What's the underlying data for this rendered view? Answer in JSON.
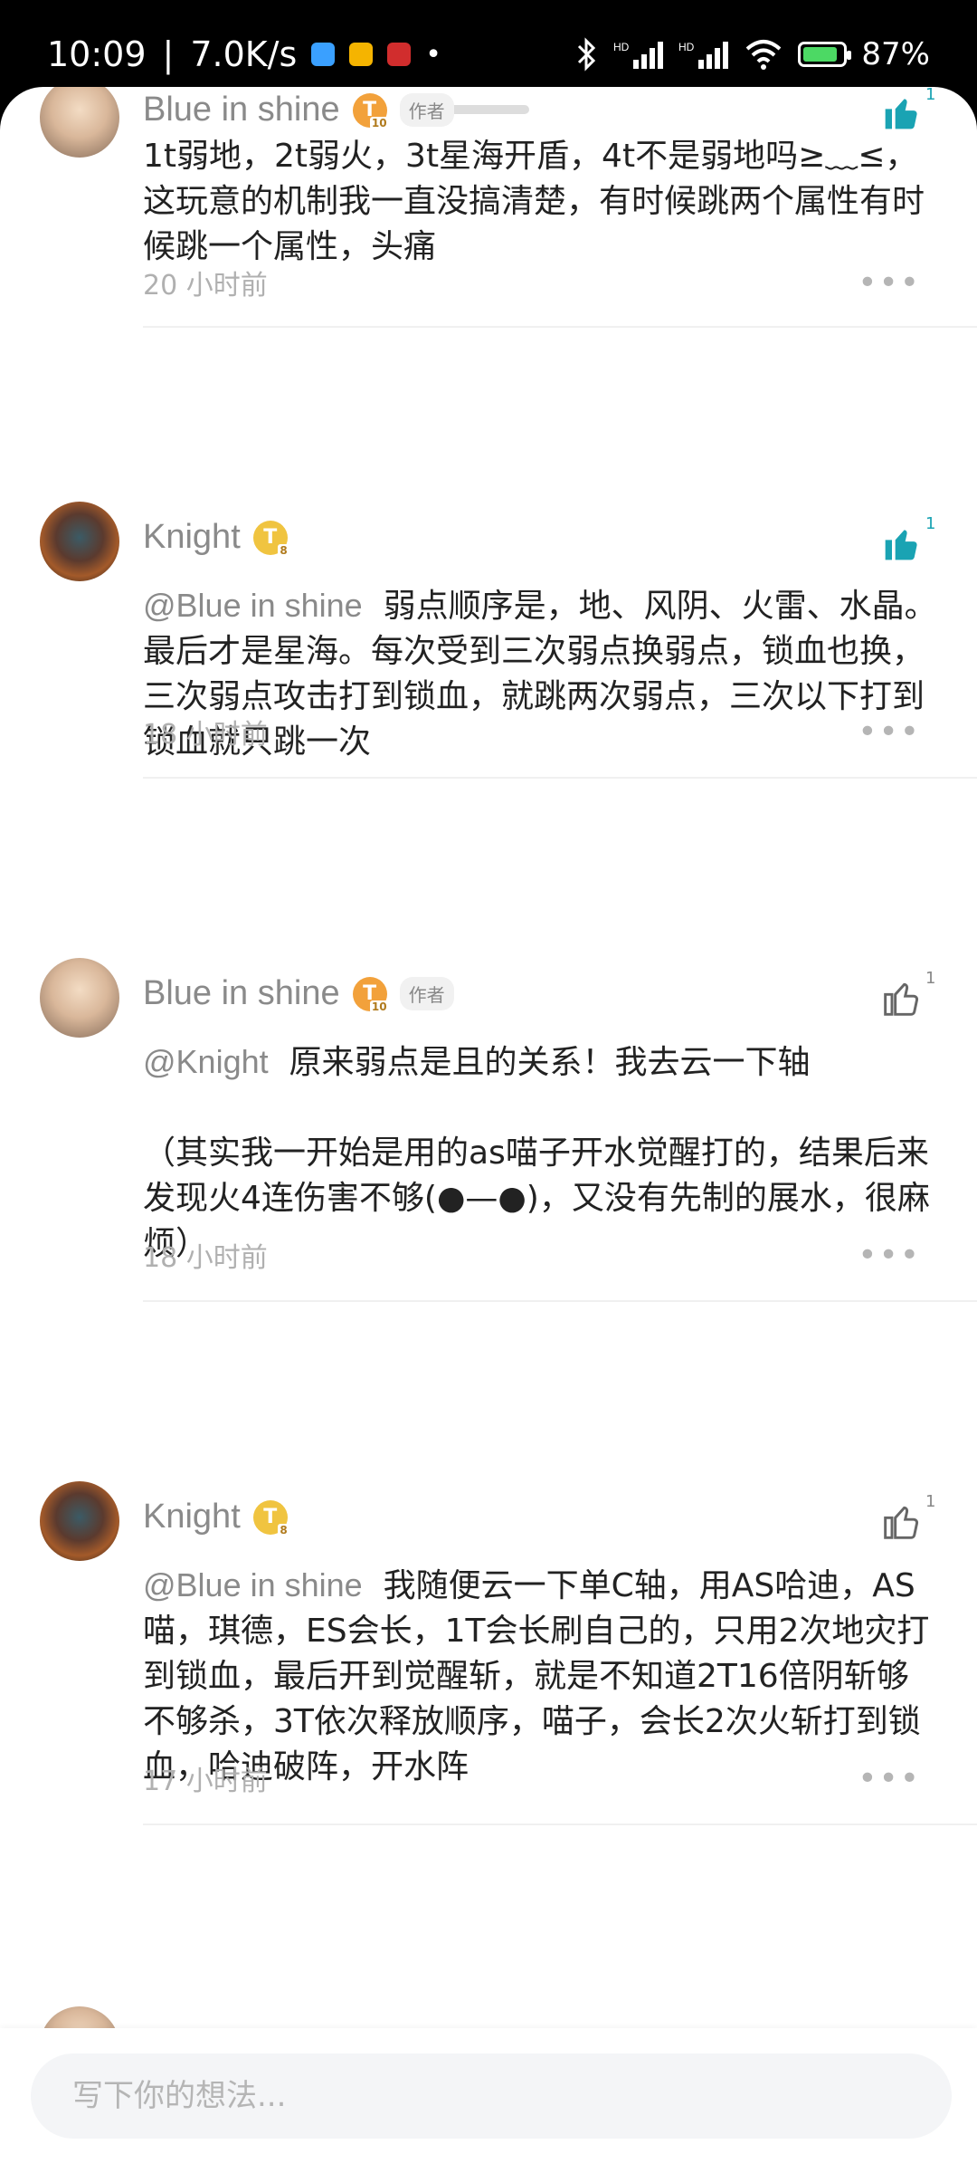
{
  "status_bar": {
    "time": "10:09",
    "speed": "7.0K/s",
    "battery": "87%",
    "battery_level": 0.87
  },
  "colors": {
    "liked": "#1aa3b3",
    "author_tag_bg": "#f1f1f1",
    "level_orange": "#f2a13b",
    "level_gold": "#f0c440"
  },
  "comments": [
    {
      "name": "Blue in shine",
      "level": "10",
      "author_tag": "作者",
      "liked": true,
      "like_count": "1",
      "mention": "",
      "text": "1t弱地，2t弱火，3t星海开盾，4t不是弱地吗≥﹏≤，这玩意的机制我一直没搞清楚，有时候跳两个属性有时候跳一个属性，头痛",
      "time": "20 小时前"
    },
    {
      "name": "Knight",
      "level": "8",
      "author_tag": "",
      "liked": true,
      "like_count": "1",
      "mention": "@Blue in shine",
      "text": "弱点顺序是，地、风阴、火雷、水晶。最后才是星海。每次受到三次弱点换弱点，锁血也换，三次弱点攻击打到锁血，就跳两次弱点，三次以下打到锁血就只跳一次",
      "time": "18 小时前"
    },
    {
      "name": "Blue in shine",
      "level": "10",
      "author_tag": "作者",
      "liked": false,
      "like_count": "1",
      "mention": "@Knight",
      "text": "原来弱点是且的关系！我去云一下轴\n\n（其实我一开始是用的as喵子开水觉醒打的，结果后来发现火4连伤害不够(●—●)，又没有先制的展水，很麻烦）",
      "time": "18 小时前"
    },
    {
      "name": "Knight",
      "level": "8",
      "author_tag": "",
      "liked": false,
      "like_count": "1",
      "mention": "@Blue in shine",
      "text": "我随便云一下单C轴，用AS哈迪，AS喵，琪德，ES会长，1T会长刷自己的，只用2次地灾打到锁血，最后开到觉醒斩，就是不知道2T16倍阴斩够不够杀，3T依次释放顺序，喵子，会长2次火斩打到锁血，哈迪破阵，开水阵",
      "time": "17 小时前"
    }
  ],
  "input": {
    "placeholder": "写下你的想法..."
  }
}
